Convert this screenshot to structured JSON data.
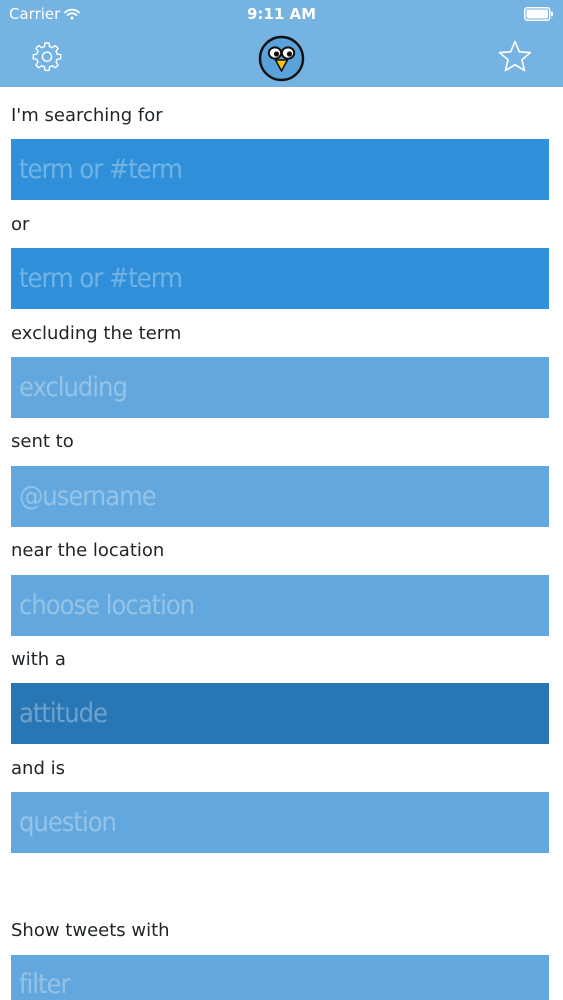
{
  "status_bar": {
    "carrier": "Carrier",
    "time": "9:11 AM"
  },
  "nav": {
    "settings_icon": "gear-icon",
    "logo_icon": "bird-logo-icon",
    "favorite_icon": "star-outline-icon"
  },
  "form": {
    "search_label": "I'm searching for",
    "search_placeholder": "term or #term",
    "or_label": "or",
    "or_placeholder": "term or #term",
    "excluding_label": "excluding the term",
    "excluding_placeholder": "excluding",
    "sent_to_label": "sent to",
    "sent_to_placeholder": "@username",
    "location_label": "near the location",
    "location_placeholder": "choose location",
    "attitude_label": "with a",
    "attitude_placeholder": "attitude",
    "question_label": "and is",
    "question_placeholder": "question",
    "filter_label": "Show tweets with",
    "filter_placeholder": "filter"
  },
  "colors": {
    "header": "#74b3e2",
    "field_blue": "#2f8fd8",
    "field_light": "#62a7dd",
    "field_dark": "#2877b4"
  }
}
